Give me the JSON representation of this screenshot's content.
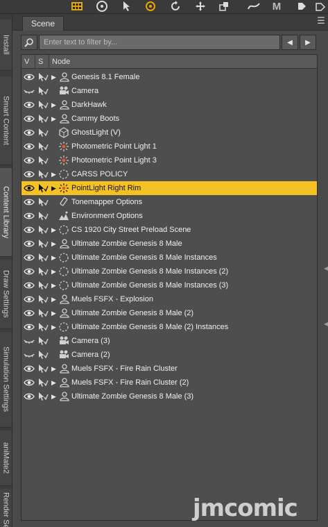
{
  "toolbar": {
    "icons": [
      "grid-tool-icon",
      "universal-tool-icon",
      "select-cursor-icon",
      "rotate-gizmo-icon",
      "rotate-icon",
      "move-icon",
      "scale-icon",
      "node-weight-icon",
      "morph-tool-icon",
      "bookmark-icon"
    ]
  },
  "side_tabs": [
    "Install",
    "Smart Content",
    "Content Library",
    "Draw Settings",
    "Simulation Settings",
    "aniMate2",
    "Render Settings"
  ],
  "scene_tab": {
    "label": "Scene"
  },
  "filter": {
    "placeholder": "Enter text to filter by..."
  },
  "columns": {
    "v": "V",
    "s": "S",
    "node": "Node"
  },
  "accent_color": "#f4c224",
  "nodes": [
    {
      "label": "Genesis 8.1 Female",
      "icon": "figure-icon",
      "expandable": true,
      "visible": true
    },
    {
      "label": "Camera",
      "icon": "camera-icon",
      "expandable": false,
      "visible": false
    },
    {
      "label": "DarkHawk",
      "icon": "figure-icon",
      "expandable": true,
      "visible": true
    },
    {
      "label": "Cammy Boots",
      "icon": "figure-icon",
      "expandable": true,
      "visible": true
    },
    {
      "label": "GhostLight (V)",
      "icon": "primitive-icon",
      "expandable": false,
      "visible": true
    },
    {
      "label": "Photometric Point Light 1",
      "icon": "point-light-icon",
      "expandable": false,
      "visible": true
    },
    {
      "label": "Photometric Point Light 3",
      "icon": "point-light-icon",
      "expandable": false,
      "visible": true
    },
    {
      "label": "CARSS POLICY",
      "icon": "group-icon",
      "expandable": true,
      "visible": true
    },
    {
      "label": "PointLight Right Rim",
      "icon": "point-light-icon",
      "expandable": true,
      "visible": true,
      "selected": true
    },
    {
      "label": "Tonemapper Options",
      "icon": "tonemapper-icon",
      "expandable": false,
      "visible": true
    },
    {
      "label": "Environment Options",
      "icon": "environment-icon",
      "expandable": false,
      "visible": true
    },
    {
      "label": "CS 1920 City Street Preload Scene",
      "icon": "group-icon",
      "expandable": true,
      "visible": true
    },
    {
      "label": "Ultimate Zombie Genesis 8 Male",
      "icon": "figure-icon",
      "expandable": true,
      "visible": true
    },
    {
      "label": "Ultimate Zombie Genesis 8 Male Instances",
      "icon": "group-icon",
      "expandable": true,
      "visible": true
    },
    {
      "label": "Ultimate Zombie Genesis 8 Male Instances (2)",
      "icon": "group-icon",
      "expandable": true,
      "visible": true
    },
    {
      "label": "Ultimate Zombie Genesis 8 Male Instances (3)",
      "icon": "group-icon",
      "expandable": true,
      "visible": true
    },
    {
      "label": "Muels FSFX - Explosion",
      "icon": "figure-icon",
      "expandable": true,
      "visible": true
    },
    {
      "label": "Ultimate Zombie Genesis 8 Male (2)",
      "icon": "figure-icon",
      "expandable": true,
      "visible": true
    },
    {
      "label": "Ultimate Zombie Genesis 8 Male (2) Instances",
      "icon": "group-icon",
      "expandable": true,
      "visible": true
    },
    {
      "label": "Camera (3)",
      "icon": "camera-icon",
      "expandable": false,
      "visible": false
    },
    {
      "label": "Camera (2)",
      "icon": "camera-icon",
      "expandable": false,
      "visible": false
    },
    {
      "label": "Muels FSFX - Fire Rain Cluster",
      "icon": "figure-icon",
      "expandable": true,
      "visible": true
    },
    {
      "label": "Muels FSFX - Fire Rain Cluster (2)",
      "icon": "figure-icon",
      "expandable": true,
      "visible": true
    },
    {
      "label": "Ultimate Zombie Genesis 8 Male (3)",
      "icon": "figure-icon",
      "expandable": true,
      "visible": true
    }
  ],
  "watermark": "jmcomic"
}
